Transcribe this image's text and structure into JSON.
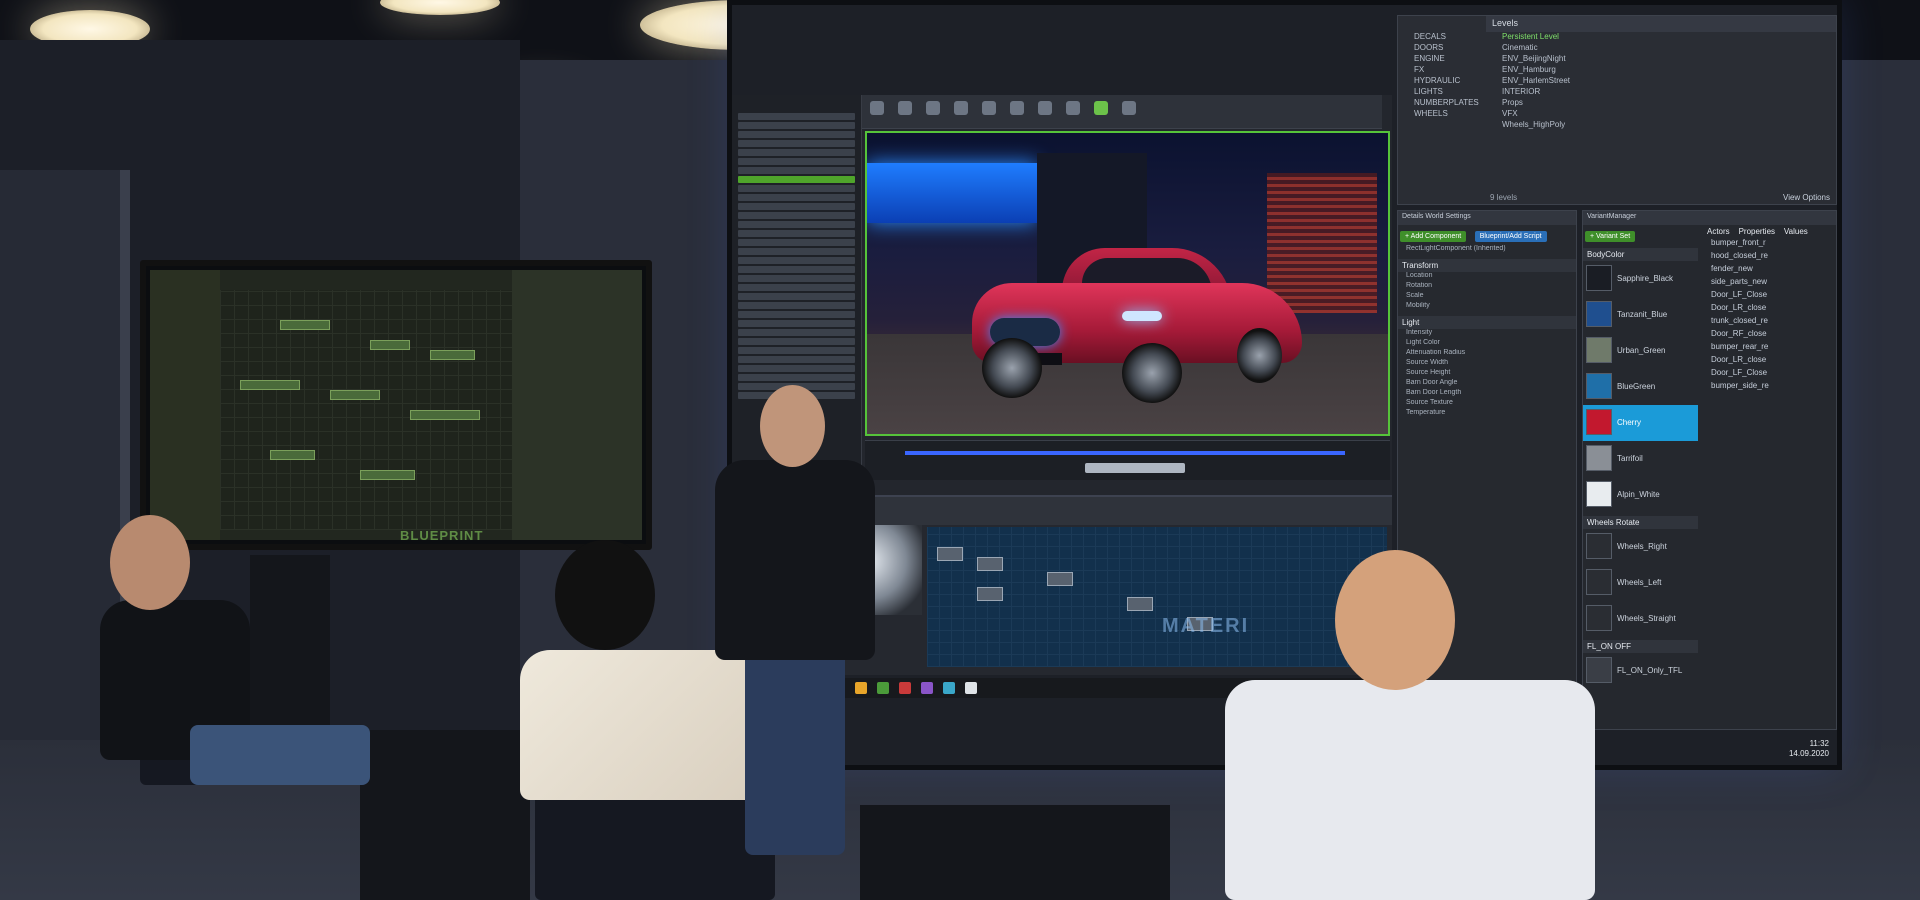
{
  "scene": {
    "description_colors": {
      "accent_green": "#56c33a",
      "accent_blue": "#1b9bd8",
      "car_red": "#c22546"
    }
  },
  "left_monitor": {
    "caption": "BLUEPRINT"
  },
  "main_display": {
    "material_caption": "MATERI",
    "levels_panel": {
      "tab_levels": "Levels",
      "layers": [
        "DECALS",
        "DOORS",
        "ENGINE",
        "FX",
        "HYDRAULIC",
        "LIGHTS",
        "NUMBERPLATES",
        "WHEELS"
      ],
      "levels": [
        "Persistent Level",
        "Cinematic",
        "ENV_BeijingNight",
        "ENV_Hamburg",
        "ENV_HarlemStreet",
        "INTERIOR",
        "Props",
        "VFX",
        "Wheels_HighPoly"
      ],
      "footer": "9 levels",
      "view_options": "View Options"
    },
    "details_panel": {
      "tabs": "Details   World Settings",
      "add_component": "+ Add Component",
      "blueprint_button": "Blueprint/Add Script",
      "component": "RectLightComponent (Inherited)",
      "transform_head": "Transform",
      "transform_rows": [
        "Location",
        "Rotation",
        "Scale",
        "Mobility"
      ],
      "light_head": "Light",
      "light_rows": [
        "Intensity",
        "Light Color",
        "Attenuation Radius",
        "Source Width",
        "Source Height",
        "Barn Door Angle",
        "Barn Door Length",
        "Source Texture",
        "Temperature"
      ]
    },
    "variant_panel": {
      "tab": "VariantManager",
      "add_variant_set": "+ Variant Set",
      "groups": [
        {
          "name": "BodyColor",
          "items": [
            {
              "label": "Sapphire_Black",
              "color": "#1a1d24"
            },
            {
              "label": "Tanzanit_Blue",
              "color": "#1f4f8f"
            },
            {
              "label": "Urban_Green",
              "color": "#6f7a6a"
            },
            {
              "label": "BlueGreen",
              "color": "#1f6fa8"
            },
            {
              "label": "Cherry",
              "color": "#c2182e",
              "selected": true
            },
            {
              "label": "Tarrifoil",
              "color": "#8a8f96"
            },
            {
              "label": "Alpin_White",
              "color": "#e8ecef"
            }
          ]
        },
        {
          "name": "Wheels Rotate",
          "items": [
            {
              "label": "Wheels_Right",
              "color": "#2a2d33"
            },
            {
              "label": "Wheels_Left",
              "color": "#2a2d33"
            },
            {
              "label": "Wheels_Straight",
              "color": "#2a2d33"
            }
          ]
        },
        {
          "name": "FL_ON OFF",
          "items": [
            {
              "label": "FL_ON_Only_TFL",
              "color": "#3a3e46"
            }
          ]
        }
      ],
      "actors_head": "Actors",
      "properties_head": "Properties",
      "values_head": "Values",
      "actors": [
        "bumper_front_r",
        "hood_closed_re",
        "fender_new",
        "side_parts_new",
        "Door_LF_Close",
        "Door_LR_close",
        "trunk_closed_re",
        "Door_RF_close",
        "bumper_rear_re",
        "Door_LR_close",
        "Door_LF_Close",
        "bumper_side_re"
      ]
    },
    "clock": {
      "time": "11:32",
      "date": "14.09.2020"
    }
  }
}
